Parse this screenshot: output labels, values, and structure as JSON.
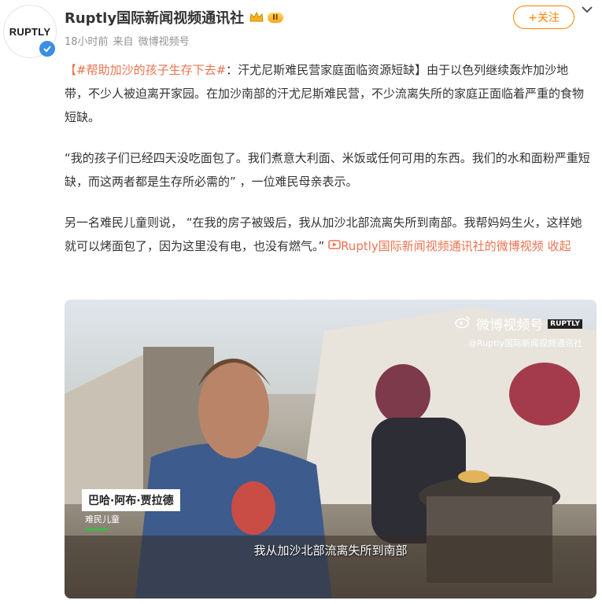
{
  "author": {
    "avatar_text": "RUPTLY",
    "name": "Ruptly国际新闻视频通讯社",
    "level_badge": "II",
    "time": "18小时前",
    "source_prefix": "来自",
    "source": "微博视频号"
  },
  "follow_label": "+关注",
  "post": {
    "topic": "【#帮助加沙的孩子生存下去#",
    "headline_rest": "：汗尤尼斯难民营家庭面临资源短缺】由于以色列继续轰炸加沙地带，不少人被迫离开家园。在加沙南部的汗尤尼斯难民营，不少流离失所的家庭正面临着严重的食物短缺。",
    "p2": "“我的孩子们已经四天没吃面包了。我们煮意大利面、米饭或任何可用的东西。我们的水和面粉严重短缺，而这两者都是生存所必需的”  ，一位难民母亲表示。",
    "p3": "另一名难民儿童则说，  “在我的房子被毁后，我从加沙北部流离失所到南部。我帮妈妈生火，这样她就可以烤面包了，因为这里没有电，也没有燃气。”",
    "video_link_label": "Ruptly国际新闻视频通讯社的微博视频",
    "collapse_label": "收起"
  },
  "video": {
    "watermark_brand": "微博视频号",
    "watermark_tag": "RUPTLY",
    "watermark_handle": "@Ruptly国际新闻视频通讯社",
    "lower_third_name": "巴哈·阿布·贾拉德",
    "lower_third_role": "难民儿童",
    "subtitle": "我从加沙北部流离失所到南部"
  },
  "colors": {
    "accent": "#ff8200",
    "topic": "#eb7350",
    "verified": "#3a8ee6"
  }
}
